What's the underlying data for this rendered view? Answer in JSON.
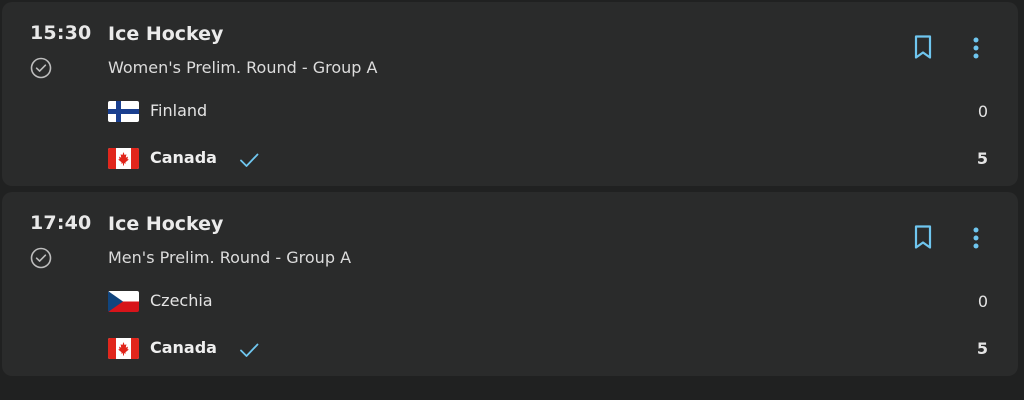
{
  "colors": {
    "background": "#202121",
    "card": "#2a2b2b",
    "accent": "#6fc6ef",
    "text": "#e6e6e6"
  },
  "matches": [
    {
      "time": "15:30",
      "status_icon": "check-circle-icon",
      "sport": "Ice Hockey",
      "event": "Women's Prelim. Round - Group A",
      "teams": [
        {
          "name": "Finland",
          "flag": "finland-flag-icon",
          "score": "0",
          "winner": false
        },
        {
          "name": "Canada",
          "flag": "canada-flag-icon",
          "score": "5",
          "winner": true
        }
      ]
    },
    {
      "time": "17:40",
      "status_icon": "check-circle-icon",
      "sport": "Ice Hockey",
      "event": "Men's Prelim. Round - Group A",
      "teams": [
        {
          "name": "Czechia",
          "flag": "czechia-flag-icon",
          "score": "0",
          "winner": false
        },
        {
          "name": "Canada",
          "flag": "canada-flag-icon",
          "score": "5",
          "winner": true
        }
      ]
    }
  ]
}
